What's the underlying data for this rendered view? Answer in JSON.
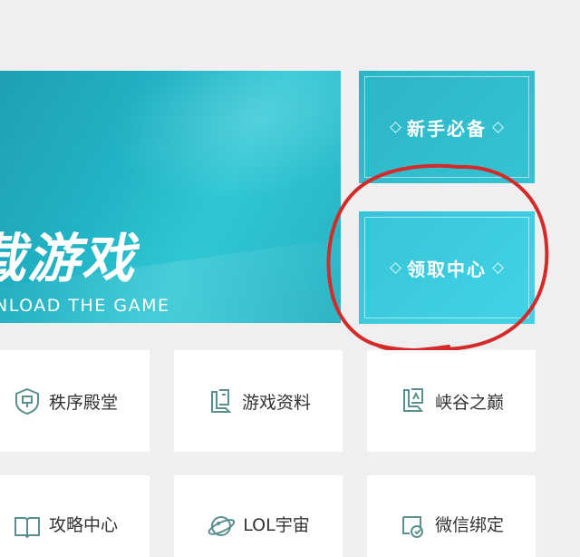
{
  "banner": {
    "title": "载游戏",
    "subtitle": "NLOAD THE GAME"
  },
  "side_buttons": [
    {
      "label": "新手必备"
    },
    {
      "label": "领取中心"
    }
  ],
  "tiles": [
    {
      "label": "秩序殿堂",
      "icon": "shield-icon"
    },
    {
      "label": "游戏资料",
      "icon": "crest-icon"
    },
    {
      "label": "峡谷之巅",
      "icon": "peak-crest-icon"
    },
    {
      "label": "攻略中心",
      "icon": "book-icon"
    },
    {
      "label": "LOL宇宙",
      "icon": "planet-icon"
    },
    {
      "label": "微信绑定",
      "icon": "link-icon"
    }
  ],
  "colors": {
    "accent": "#2bb6c6",
    "accent_light": "#41d3e6",
    "icon": "#5a8f90",
    "annotation_red": "#d42a2a",
    "background": "#efefef"
  }
}
